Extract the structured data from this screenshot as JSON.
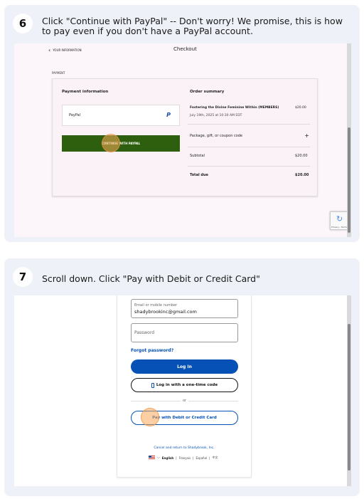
{
  "step6": {
    "number": "6",
    "instruction": "Click \"Continue with PayPal\" -- Don't worry! We promise, this is how to pay even if you don't have a PayPal account.",
    "checkout": {
      "back_link": "YOUR INFORMATION",
      "title": "Checkout",
      "section_label": "PAYMENT",
      "payment_info_heading": "Payment information",
      "payment_option": "PayPal",
      "continue_button": "CONTINUE WITH PAYPAL",
      "order_summary_heading": "Order summary",
      "item_name": "Fostering the Divine Feminine Within (MEMBERS)",
      "item_price": "$20.00",
      "item_date": "July 19th, 2025 at 10:30 AM EDT",
      "package_label": "Package, gift, or coupon code",
      "package_plus": "+",
      "subtotal_label": "Subtotal",
      "subtotal_value": "$20.00",
      "total_label": "Total due",
      "total_value": "$20.00",
      "recaptcha_terms": "Privacy - Terms"
    },
    "accent_color": "#2d5f0e"
  },
  "step7": {
    "number": "7",
    "instruction": "Scroll down. Click \"Pay with Debit or Credit Card\"",
    "login": {
      "email_label": "Email or mobile number",
      "email_value": "shadybrookinc@gmail.com",
      "password_placeholder": "Password",
      "forgot_password": "Forgot password?",
      "login_button": "Log In",
      "one_time_code_button": "Log in with a one-time code",
      "or_label": "or",
      "pay_card_button": "Pay with Debit or Credit Card",
      "cancel_link": "Cancel and return to Shadybrook, Inc.",
      "languages": [
        "English",
        "Français",
        "Español",
        "中文"
      ]
    },
    "brand_color": "#0551b5"
  }
}
